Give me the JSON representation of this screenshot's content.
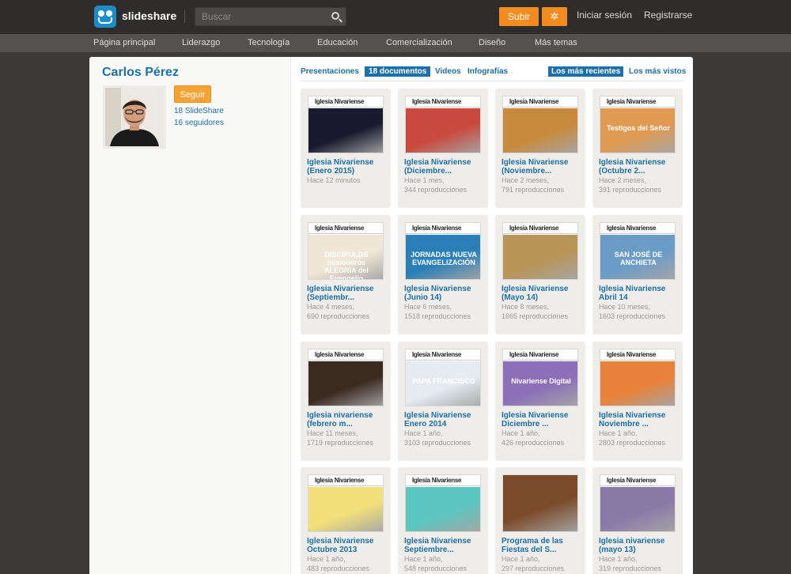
{
  "header": {
    "brand": "slideshare",
    "search_placeholder": "Buscar",
    "upload_label": "Subir",
    "login_label": "Iniciar sesión",
    "signup_label": "Registrarse"
  },
  "nav": {
    "items": [
      {
        "label": "Página principal"
      },
      {
        "label": "Liderazgo"
      },
      {
        "label": "Tecnología"
      },
      {
        "label": "Educación"
      },
      {
        "label": "Comercialización"
      },
      {
        "label": "Diseño"
      },
      {
        "label": "Más temas"
      }
    ]
  },
  "profile": {
    "name": "Carlos Pérez",
    "follow_label": "Seguir",
    "slideshare_count": "18 SlideShare",
    "followers_count": "16 seguidores"
  },
  "tabs": [
    {
      "label": "Presentaciones",
      "selected": false
    },
    {
      "label": "18 documentos",
      "selected": true
    },
    {
      "label": "Videos",
      "selected": false
    },
    {
      "label": "Infografías",
      "selected": false
    }
  ],
  "sort": [
    {
      "label": "Los más recientes",
      "selected": true
    },
    {
      "label": "Los más vistos",
      "selected": false
    }
  ],
  "documents": [
    {
      "title": "Iglesia Nivariense (Enero 2015)",
      "date": "Hace 12 minutos",
      "views": "",
      "thumb_header": "Iglesia Nivariense",
      "thumb_color": "#1a1a2e",
      "thumb_text": ""
    },
    {
      "title": "Iglesia Nivariense (Diciembre...",
      "date": "Hace 1 mes,",
      "views": "344 reproducciones",
      "thumb_header": "Iglesia Nivariense",
      "thumb_color": "#c9493e",
      "thumb_text": ""
    },
    {
      "title": "Iglesia Nivariense (Noviembre...",
      "date": "Hace 2 meses,",
      "views": "791 reproducciones",
      "thumb_header": "Iglesia Nivariense",
      "thumb_color": "#c88a3c",
      "thumb_text": ""
    },
    {
      "title": "Iglesia Nivariense (Octubre 2...",
      "date": "Hace 2 meses,",
      "views": "391 reproducciones",
      "thumb_header": "Iglesia Nivariense",
      "thumb_color": "#e09a52",
      "thumb_text": "Testigos del Señor"
    },
    {
      "title": "Iglesia Nivariense (Septiembr...",
      "date": "Hace 4 meses,",
      "views": "690 reproducciones",
      "thumb_header": "Iglesia Nivariense",
      "thumb_color": "#f0e6d6",
      "thumb_text": "DISCÍPULOS misioneros ALEGRÍA del Evangelio"
    },
    {
      "title": "Iglesia Nivariense (Junio 14)",
      "date": "Hace 6 meses,",
      "views": "1518 reproducciones",
      "thumb_header": "Iglesia Nivariense",
      "thumb_color": "#2a7fb8",
      "thumb_text": "JORNADAS NUEVA EVANGELIZACIÓN"
    },
    {
      "title": "Iglesia Nivariense (Mayo 14)",
      "date": "Hace 8 meses,",
      "views": "1665 reproducciones",
      "thumb_header": "Iglesia Nivariense",
      "thumb_color": "#b89558",
      "thumb_text": ""
    },
    {
      "title": "Iglesia Nivariense Abril 14",
      "date": "Hace 10 meses,",
      "views": "1603 reproducciones",
      "thumb_header": "Iglesia Nivariense",
      "thumb_color": "#6b9cc6",
      "thumb_text": "SAN JOSÉ DE ANCHIETA"
    },
    {
      "title": "Iglesia nivariense (febrero m...",
      "date": "Hace 11 meses,",
      "views": "1719 reproducciones",
      "thumb_header": "Iglesia Nivariense",
      "thumb_color": "#3a2a20",
      "thumb_text": ""
    },
    {
      "title": "Iglesia Nivariense Enero 2014",
      "date": "Hace 1 año,",
      "views": "3103 reproducciones",
      "thumb_header": "Iglesia Nivariense",
      "thumb_color": "#e4ecf2",
      "thumb_text": "PAPA FRANCISCO"
    },
    {
      "title": "Iglesia Nivariense Diciembre ...",
      "date": "Hace 1 año,",
      "views": "426 reproducciones",
      "thumb_header": "Iglesia Nivariense",
      "thumb_color": "#8b6fb8",
      "thumb_text": "Nivariense Digital"
    },
    {
      "title": "Iglesia Nivariense Noviembre ...",
      "date": "Hace 1 año,",
      "views": "2803 reproducciones",
      "thumb_header": "Iglesia Nivariense",
      "thumb_color": "#e8823a",
      "thumb_text": ""
    },
    {
      "title": "Iglesia Nivariense Octubre 2013",
      "date": "Hace 1 año,",
      "views": "483 reproducciones",
      "thumb_header": "Iglesia Nivariense",
      "thumb_color": "#f2e07a",
      "thumb_text": ""
    },
    {
      "title": "Iglesia Nivariense Septiembre...",
      "date": "Hace 1 año,",
      "views": "548 reproducciones",
      "thumb_header": "Iglesia Nivariense",
      "thumb_color": "#5cc7c0",
      "thumb_text": ""
    },
    {
      "title": "Programa de las Fiestas del S...",
      "date": "Hace 1 año,",
      "views": "297 reproducciones",
      "thumb_header": "",
      "thumb_color": "#7a4a2a",
      "thumb_text": ""
    },
    {
      "title": "Iglesia nivariense (mayo 13)",
      "date": "Hace 1 año,",
      "views": "319 reproducciones",
      "thumb_header": "Iglesia Nivariense",
      "thumb_color": "#8a7aa8",
      "thumb_text": ""
    }
  ]
}
